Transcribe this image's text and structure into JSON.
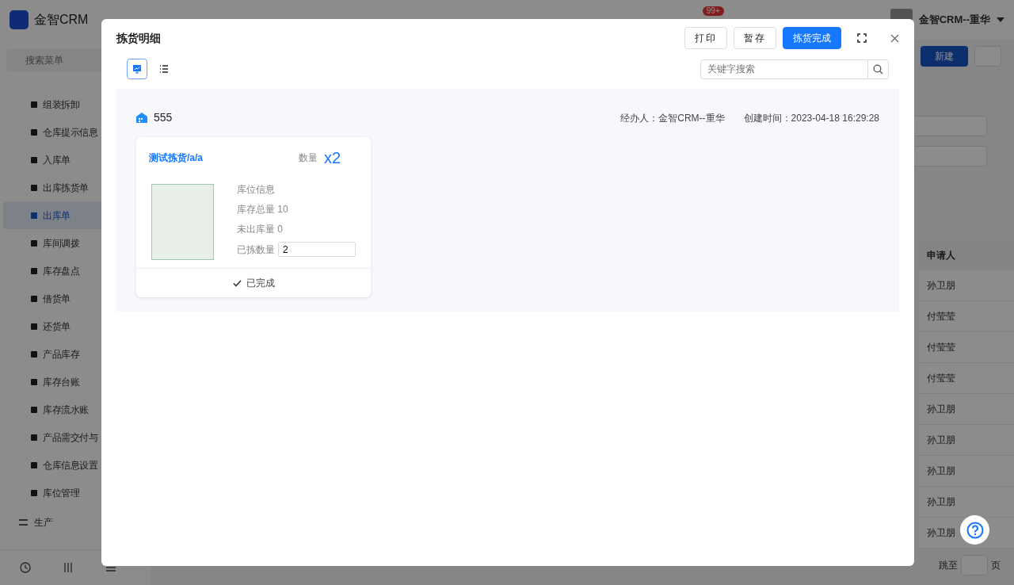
{
  "app": {
    "logo": "金智CRM",
    "menu_search": {
      "placeholder": "搜索菜单"
    },
    "sidebar": {
      "items": [
        {
          "label": "组装拆卸",
          "selected": false
        },
        {
          "label": "仓库提示信息",
          "selected": false
        },
        {
          "label": "入库单",
          "selected": false
        },
        {
          "label": "出库拣货单",
          "selected": false
        },
        {
          "label": "出库单",
          "selected": true
        },
        {
          "label": "库间调拨",
          "selected": false
        },
        {
          "label": "库存盘点",
          "selected": false
        },
        {
          "label": "借货单",
          "selected": false
        },
        {
          "label": "还货单",
          "selected": false
        },
        {
          "label": "产品库存",
          "selected": false
        },
        {
          "label": "库存台账",
          "selected": false
        },
        {
          "label": "库存流水账",
          "selected": false
        },
        {
          "label": "产品需交付与",
          "selected": false
        },
        {
          "label": "仓库信息设置",
          "selected": false
        },
        {
          "label": "库位管理",
          "selected": false
        }
      ],
      "section": "生产"
    },
    "header": {
      "badge": "99+",
      "user": "金智CRM--重华"
    },
    "toolbar": {
      "new_button": "新建"
    },
    "table": {
      "columns": [
        "申请人"
      ],
      "rows": [
        [
          "孙卫朋"
        ],
        [
          "付莹莹"
        ],
        [
          "付莹莹"
        ],
        [
          "付莹莹"
        ],
        [
          "孙卫朋"
        ],
        [
          "孙卫朋"
        ],
        [
          "孙卫朋"
        ],
        [
          "孙卫朋"
        ],
        [
          "孙卫朋"
        ]
      ]
    },
    "pagination": {
      "jump_label": "跳至",
      "page_label": "页"
    }
  },
  "modal": {
    "title": "拣货明细",
    "buttons": [
      {
        "label": "打印",
        "kind": "default"
      },
      {
        "label": "暂存",
        "kind": "default"
      },
      {
        "label": "拣货完成",
        "kind": "primary"
      }
    ],
    "view_modes": [
      {
        "kind": "board",
        "selected": true
      },
      {
        "kind": "list",
        "selected": false
      }
    ],
    "search": {
      "placeholder": "关键字搜索"
    },
    "warehouse": {
      "name": "555",
      "handler": "经办人：金智CRM--重华",
      "created": "创建时间：2023-04-18 16:29:28"
    },
    "items": [
      {
        "name": "测试拣货/a/a",
        "qty_label": "数量",
        "qty": "x2",
        "location_label": "库位信息",
        "stock_total": "库存总量 10",
        "unshipped": "未出库量 0",
        "picked_label": "已拣数量",
        "picked_value": "2",
        "status": "已完成",
        "completed": true
      }
    ]
  }
}
